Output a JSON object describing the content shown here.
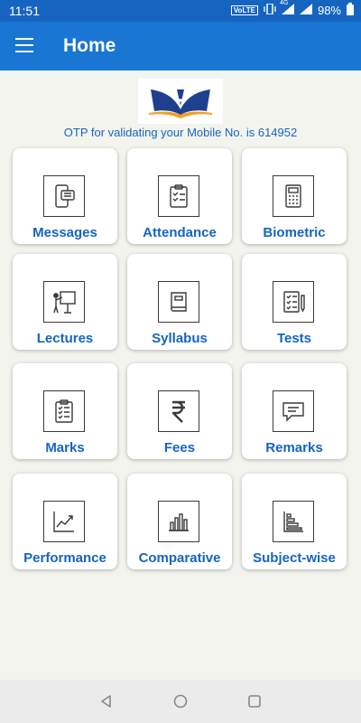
{
  "status": {
    "time": "11:51",
    "volte": "VoLTE",
    "network": "4G",
    "battery": "98%"
  },
  "appbar": {
    "title": "Home"
  },
  "otp_text": "OTP for validating your Mobile No. is 614952",
  "tiles": [
    {
      "label": "Messages",
      "icon": "messages-icon"
    },
    {
      "label": "Attendance",
      "icon": "clipboard-check-icon"
    },
    {
      "label": "Biometric",
      "icon": "calculator-icon"
    },
    {
      "label": "Lectures",
      "icon": "teacher-board-icon"
    },
    {
      "label": "Syllabus",
      "icon": "book-icon"
    },
    {
      "label": "Tests",
      "icon": "test-sheet-icon"
    },
    {
      "label": "Marks",
      "icon": "marks-clipboard-icon"
    },
    {
      "label": "Fees",
      "icon": "rupee-icon"
    },
    {
      "label": "Remarks",
      "icon": "speech-bubble-icon"
    },
    {
      "label": "Performance",
      "icon": "line-chart-icon"
    },
    {
      "label": "Comparative",
      "icon": "bar-chart-icon"
    },
    {
      "label": "Subject-wise",
      "icon": "horizontal-bar-chart-icon"
    }
  ],
  "colors": {
    "appbar": "#1976d2",
    "statusbar": "#1565c0",
    "accent": "#1565c0",
    "background": "#f4f4ef"
  }
}
